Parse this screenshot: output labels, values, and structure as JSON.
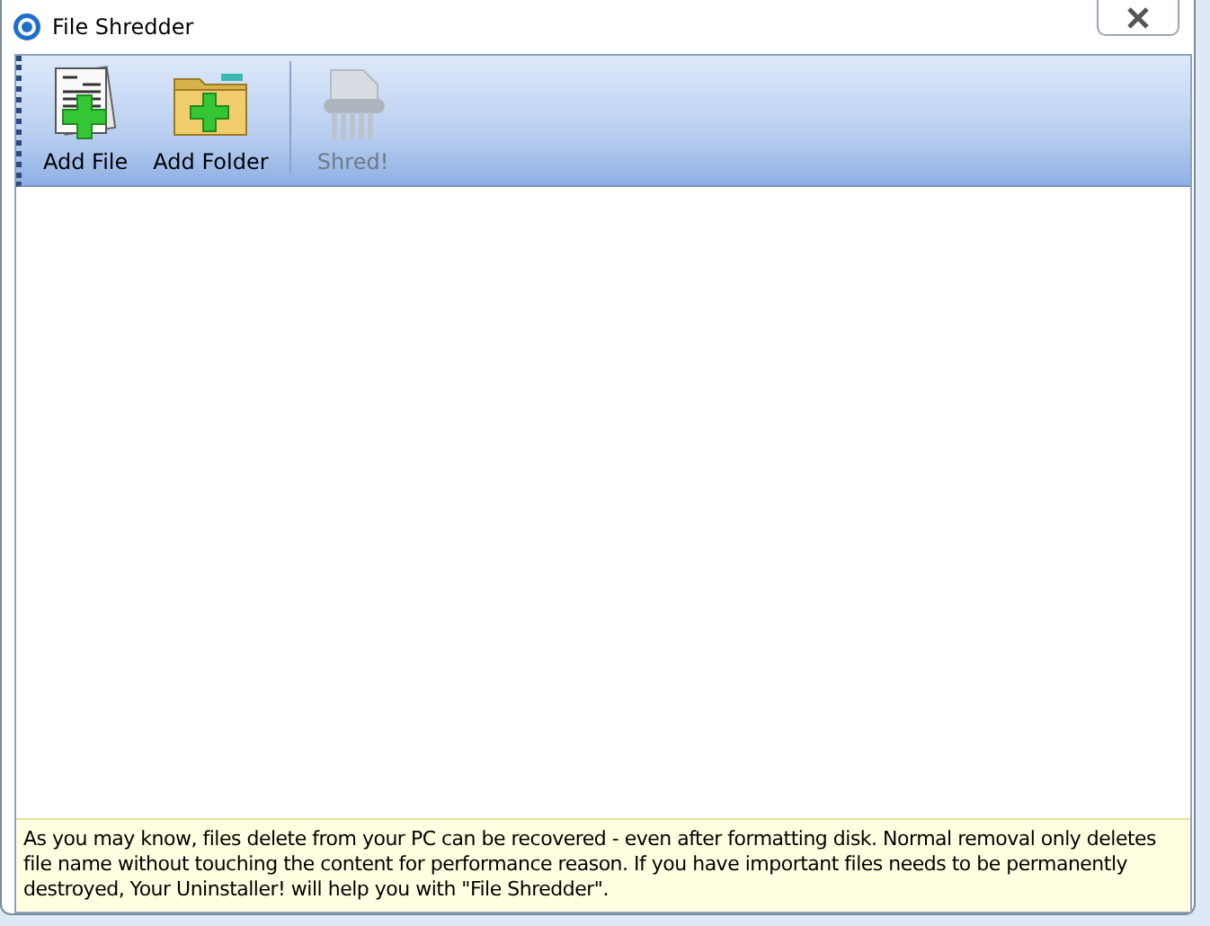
{
  "window": {
    "title": "File Shredder"
  },
  "toolbar": [
    {
      "kind": "file",
      "label": "Add File",
      "disabled": false
    },
    {
      "kind": "folder",
      "label": "Add Folder",
      "disabled": false
    },
    {
      "kind": "shredder",
      "label": "Shred!",
      "disabled": true
    }
  ],
  "info": "As you may know, files delete from your PC can be recovered - even after formatting disk. Normal removal only deletes file name without touching the content for performance reason. If you have important files needs to be permanently destroyed, Your Uninstaller! will help you with \"File Shredder\"."
}
